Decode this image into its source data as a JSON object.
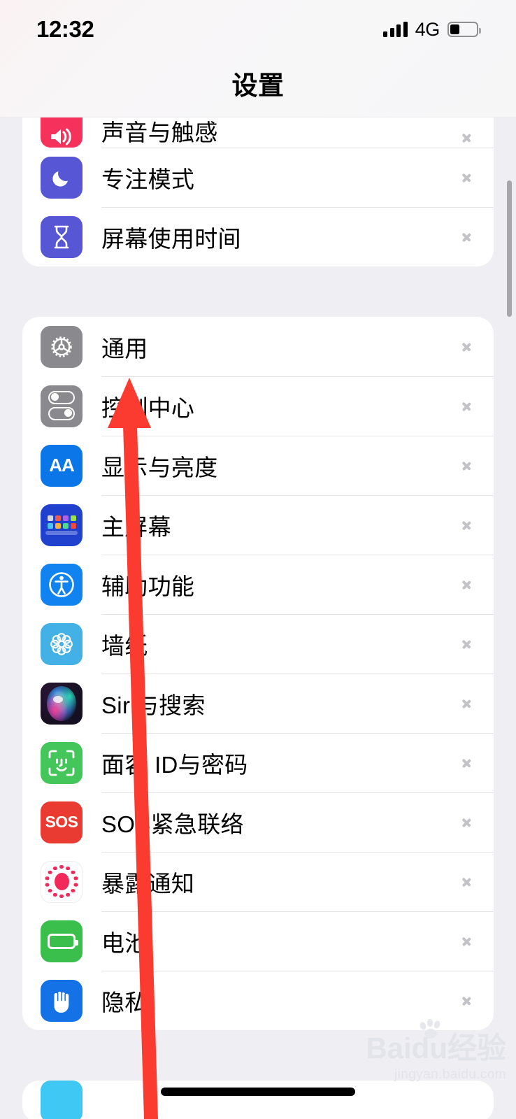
{
  "status_bar": {
    "time": "12:32",
    "network": "4G",
    "signal_icon": "signal-bars-icon",
    "battery_icon": "battery-icon",
    "battery_level_percent": 35
  },
  "header": {
    "title": "设置"
  },
  "groups": [
    {
      "name": "group-clipped-top",
      "clipped": true,
      "items": [
        {
          "label": "声音与触感",
          "icon": "sound-haptics-icon",
          "partial": true
        },
        {
          "label": "专注模式",
          "icon": "focus-mode-icon",
          "partial": false
        },
        {
          "label": "屏幕使用时间",
          "icon": "screen-time-icon",
          "partial": false
        }
      ]
    },
    {
      "name": "group-system",
      "clipped": false,
      "items": [
        {
          "label": "通用",
          "icon": "general-gear-icon",
          "partial": false
        },
        {
          "label": "控制中心",
          "icon": "control-center-icon",
          "partial": false
        },
        {
          "label": "显示与亮度",
          "icon": "display-brightness-icon",
          "partial": false
        },
        {
          "label": "主屏幕",
          "icon": "home-screen-icon",
          "partial": false
        },
        {
          "label": "辅助功能",
          "icon": "accessibility-icon",
          "partial": false
        },
        {
          "label": "墙纸",
          "icon": "wallpaper-icon",
          "partial": false
        },
        {
          "label": "Siri与搜索",
          "icon": "siri-search-icon",
          "partial": false
        },
        {
          "label": "面容 ID与密码",
          "icon": "face-id-passcode-icon",
          "partial": false
        },
        {
          "label": "SOS紧急联络",
          "icon": "emergency-sos-icon",
          "partial": false
        },
        {
          "label": "暴露通知",
          "icon": "exposure-notifications-icon",
          "partial": false
        },
        {
          "label": "电池",
          "icon": "battery-settings-icon",
          "partial": false
        },
        {
          "label": "隐私",
          "icon": "privacy-icon",
          "partial": false
        }
      ]
    }
  ],
  "icon_labels": {
    "display": "AA",
    "sos": "SOS"
  },
  "annotation": {
    "arrow_color": "#FB3B30",
    "points_at": "通用"
  },
  "watermark": {
    "main": "Baidu经验",
    "sub": "jingyan.baidu.com"
  },
  "colors": {
    "background": "#EFEEF3",
    "card": "#FFFFFF",
    "separator": "#E4E4E6",
    "chevron": "#C3C3C7",
    "label": "#000000"
  }
}
